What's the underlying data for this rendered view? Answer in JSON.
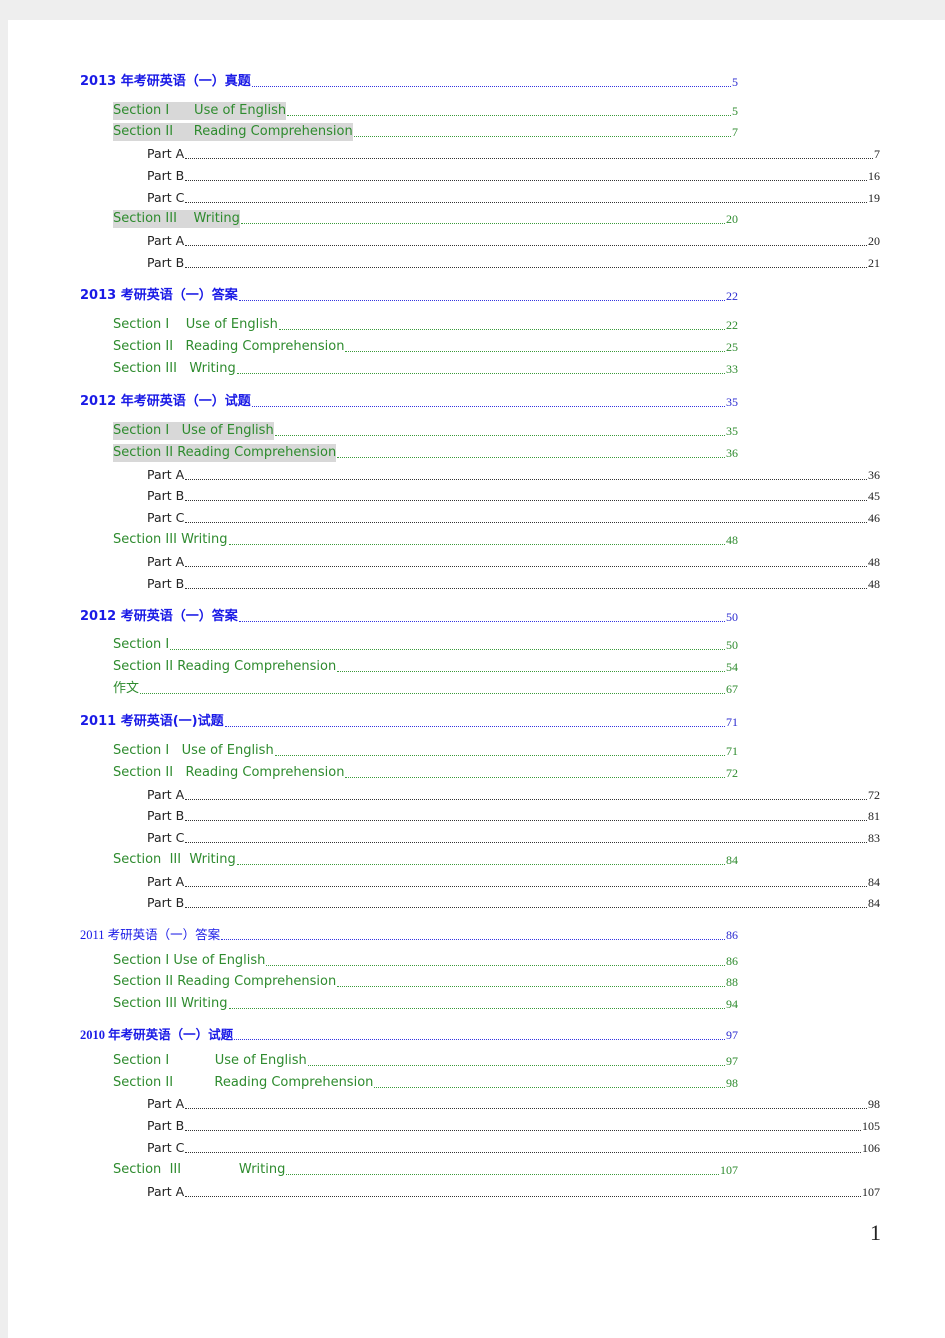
{
  "toc": [
    {
      "level": "h",
      "text": "2013 年考研英语（一）真题",
      "page": "5"
    },
    {
      "level": "s",
      "text": "Section I      Use of English",
      "page": "5",
      "highlight": true
    },
    {
      "level": "s",
      "text": "Section II     Reading Comprehension",
      "page": "7",
      "highlight": true
    },
    {
      "level": "p",
      "text": "Part A",
      "page": "7"
    },
    {
      "level": "p",
      "text": "Part B",
      "page": "16"
    },
    {
      "level": "p",
      "text": "Part C",
      "page": "19"
    },
    {
      "level": "s",
      "text": "Section III    Writing",
      "page": "20",
      "highlight": true
    },
    {
      "level": "p",
      "text": "Part A",
      "page": "20"
    },
    {
      "level": "p",
      "text": "Part B",
      "page": "21"
    },
    {
      "level": "h",
      "text": "2013 考研英语（一）答案",
      "page": "22"
    },
    {
      "level": "s",
      "text": "Section I    Use of English",
      "page": "22"
    },
    {
      "level": "s",
      "text": "Section II   Reading Comprehension",
      "page": "25"
    },
    {
      "level": "s",
      "text": "Section III   Writing",
      "page": "33"
    },
    {
      "level": "h",
      "text": "2012 年考研英语（一）试题",
      "page": "35"
    },
    {
      "level": "s",
      "text": "Section I   Use of English",
      "page": "35",
      "highlight": true
    },
    {
      "level": "s",
      "text": "Section II Reading Comprehension",
      "page": "36",
      "highlight": true
    },
    {
      "level": "p",
      "text": "Part A",
      "page": "36"
    },
    {
      "level": "p",
      "text": "Part B",
      "page": "45"
    },
    {
      "level": "p",
      "text": "Part C",
      "page": "46"
    },
    {
      "level": "s",
      "text": "Section III Writing",
      "page": "48"
    },
    {
      "level": "p",
      "text": "Part A",
      "page": "48"
    },
    {
      "level": "p",
      "text": "Part B",
      "page": "48"
    },
    {
      "level": "h",
      "text": "2012 考研英语（一）答案",
      "page": "50"
    },
    {
      "level": "s",
      "text": "Section I",
      "page": "50"
    },
    {
      "level": "s",
      "text": "Section II Reading Comprehension",
      "page": "54"
    },
    {
      "level": "s",
      "text": "作文",
      "page": "67"
    },
    {
      "level": "h",
      "text": "2011 考研英语(一)试题",
      "page": "71"
    },
    {
      "level": "s",
      "text": "Section I   Use of English",
      "page": "71"
    },
    {
      "level": "s",
      "text": "Section II   Reading Comprehension",
      "page": "72"
    },
    {
      "level": "p",
      "text": "Part A",
      "page": "72"
    },
    {
      "level": "p",
      "text": "Part B",
      "page": "81"
    },
    {
      "level": "p",
      "text": "Part C",
      "page": "83"
    },
    {
      "level": "s",
      "text": "Section  III  Writing",
      "page": "84"
    },
    {
      "level": "p",
      "text": "Part A",
      "page": "84"
    },
    {
      "level": "p",
      "text": "Part B",
      "page": "84"
    },
    {
      "level": "h",
      "text": "2011 考研英语（一）答案",
      "page": "86",
      "style": "serif"
    },
    {
      "level": "s",
      "text": "Section I Use of English",
      "page": "86"
    },
    {
      "level": "s",
      "text": "Section II Reading Comprehension",
      "page": "88"
    },
    {
      "level": "s",
      "text": "Section III Writing",
      "page": "94"
    },
    {
      "level": "h",
      "text": "2010 年考研英语（一）试题",
      "page": "97",
      "style": "serif-bold"
    },
    {
      "level": "s",
      "text": "Section I           Use of English",
      "page": "97"
    },
    {
      "level": "s",
      "text": "Section II          Reading Comprehension",
      "page": "98"
    },
    {
      "level": "p",
      "text": "Part A",
      "page": "98"
    },
    {
      "level": "p",
      "text": "Part B",
      "page": "105"
    },
    {
      "level": "p",
      "text": "Part C",
      "page": "106"
    },
    {
      "level": "s",
      "text": "Section  III              Writing",
      "page": "107"
    },
    {
      "level": "p",
      "text": "Part A",
      "page": "107"
    }
  ],
  "page_number": "1"
}
